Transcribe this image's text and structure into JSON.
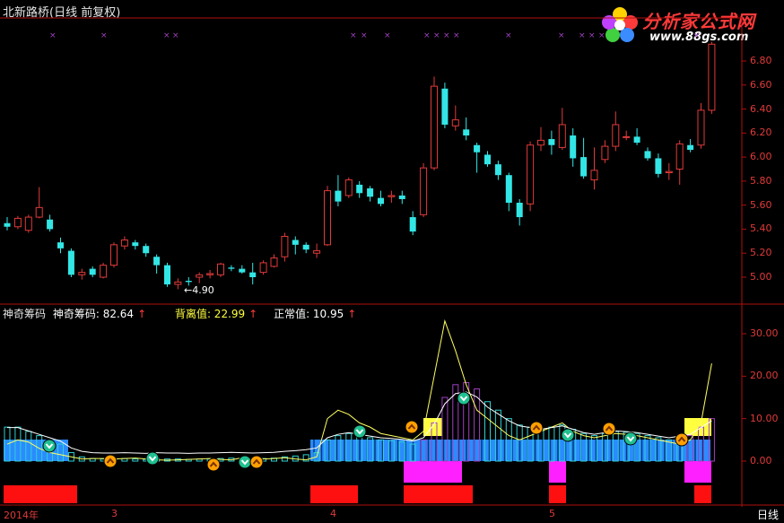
{
  "chart": {
    "title": "北新路桥(日线 前复权)",
    "price_axis_labels": [
      "6.80",
      "6.60",
      "6.40",
      "6.20",
      "6.00",
      "5.80",
      "5.60",
      "5.40",
      "5.20",
      "5.00"
    ],
    "min_price_annotation": "←4.90",
    "indicator_axis_labels": [
      "30.00",
      "20.00",
      "10.00",
      "0.00"
    ],
    "date_labels": [
      "2014年",
      "3",
      "4",
      "5"
    ],
    "period_label": "日线"
  },
  "indicator": {
    "name": "神奇筹码",
    "value1_label": "神奇筹码: 82.64",
    "value2_label": "背离值: 22.99",
    "value3_label": "正常值: 10.95",
    "arrow": "↑"
  },
  "watermark": {
    "brand": "分析家公式网",
    "url": "www.88gs.com"
  },
  "colors": {
    "up": "#e03a3a",
    "down": "#33e6e6",
    "axis": "#b01010",
    "purple": "#a040c0",
    "magenta": "#ff20ff",
    "yellow": "#ffff40",
    "blue": "#2a8cff",
    "red_block": "#ff1010"
  },
  "chart_data": {
    "type": "candlestick",
    "y_range": [
      4.85,
      6.92
    ],
    "candles": [
      [
        5.45,
        5.42,
        5.5,
        5.39
      ],
      [
        5.42,
        5.49,
        5.51,
        5.4
      ],
      [
        5.39,
        5.5,
        5.52,
        5.37
      ],
      [
        5.5,
        5.58,
        5.75,
        5.49
      ],
      [
        5.48,
        5.4,
        5.52,
        5.38
      ],
      [
        5.29,
        5.24,
        5.33,
        5.2
      ],
      [
        5.22,
        5.02,
        5.24,
        5.0
      ],
      [
        5.02,
        5.04,
        5.07,
        4.98
      ],
      [
        5.07,
        5.02,
        5.09,
        5.0
      ],
      [
        5.0,
        5.1,
        5.12,
        4.99
      ],
      [
        5.1,
        5.27,
        5.29,
        5.08
      ],
      [
        5.26,
        5.31,
        5.34,
        5.23
      ],
      [
        5.29,
        5.26,
        5.31,
        5.23
      ],
      [
        5.26,
        5.2,
        5.28,
        5.17
      ],
      [
        5.17,
        5.1,
        5.19,
        5.03
      ],
      [
        5.1,
        4.94,
        5.12,
        4.92
      ],
      [
        4.94,
        4.96,
        4.99,
        4.9
      ],
      [
        4.97,
        4.96,
        5.0,
        4.93
      ],
      [
        5.0,
        5.02,
        5.04,
        4.95
      ],
      [
        5.02,
        5.03,
        5.06,
        4.99
      ],
      [
        5.02,
        5.11,
        5.12,
        5.0
      ],
      [
        5.08,
        5.07,
        5.1,
        5.05
      ],
      [
        5.07,
        5.04,
        5.1,
        5.03
      ],
      [
        5.04,
        5.0,
        5.12,
        4.94
      ],
      [
        5.04,
        5.12,
        5.14,
        5.02
      ],
      [
        5.09,
        5.16,
        5.19,
        5.08
      ],
      [
        5.17,
        5.34,
        5.37,
        5.13
      ],
      [
        5.31,
        5.27,
        5.34,
        5.19
      ],
      [
        5.27,
        5.23,
        5.29,
        5.2
      ],
      [
        5.2,
        5.22,
        5.28,
        5.16
      ],
      [
        5.27,
        5.72,
        5.76,
        5.26
      ],
      [
        5.72,
        5.63,
        5.85,
        5.59
      ],
      [
        5.68,
        5.81,
        5.83,
        5.66
      ],
      [
        5.77,
        5.7,
        5.8,
        5.66
      ],
      [
        5.74,
        5.67,
        5.76,
        5.63
      ],
      [
        5.66,
        5.61,
        5.72,
        5.59
      ],
      [
        5.67,
        5.68,
        5.72,
        5.62
      ],
      [
        5.68,
        5.65,
        5.72,
        5.61
      ],
      [
        5.5,
        5.38,
        5.55,
        5.35
      ],
      [
        5.52,
        5.91,
        5.95,
        5.5
      ],
      [
        5.91,
        6.59,
        6.67,
        5.89
      ],
      [
        6.57,
        6.27,
        6.62,
        6.24
      ],
      [
        6.26,
        6.31,
        6.43,
        6.22
      ],
      [
        6.23,
        6.18,
        6.33,
        6.14
      ],
      [
        6.1,
        6.04,
        6.12,
        5.87
      ],
      [
        6.02,
        5.94,
        6.05,
        5.92
      ],
      [
        5.94,
        5.85,
        5.97,
        5.81
      ],
      [
        5.85,
        5.62,
        5.87,
        5.55
      ],
      [
        5.62,
        5.5,
        5.65,
        5.43
      ],
      [
        5.61,
        6.1,
        6.13,
        5.55
      ],
      [
        6.1,
        6.14,
        6.25,
        6.05
      ],
      [
        6.15,
        6.1,
        6.22,
        6.02
      ],
      [
        6.08,
        6.27,
        6.41,
        6.06
      ],
      [
        6.18,
        5.99,
        6.24,
        5.92
      ],
      [
        6.0,
        5.84,
        6.16,
        5.82
      ],
      [
        5.81,
        5.89,
        6.08,
        5.73
      ],
      [
        5.98,
        6.09,
        6.14,
        5.95
      ],
      [
        6.09,
        6.27,
        6.38,
        6.05
      ],
      [
        6.17,
        6.17,
        6.22,
        6.14
      ],
      [
        6.17,
        6.12,
        6.24,
        6.1
      ],
      [
        6.05,
        5.99,
        6.08,
        5.97
      ],
      [
        5.99,
        5.86,
        6.03,
        5.83
      ],
      [
        5.87,
        5.88,
        5.95,
        5.81
      ],
      [
        5.9,
        6.11,
        6.14,
        5.77
      ],
      [
        6.1,
        6.06,
        6.15,
        6.04
      ],
      [
        6.1,
        6.39,
        6.45,
        6.07
      ],
      [
        6.39,
        6.94,
        6.96,
        6.36
      ]
    ]
  }
}
